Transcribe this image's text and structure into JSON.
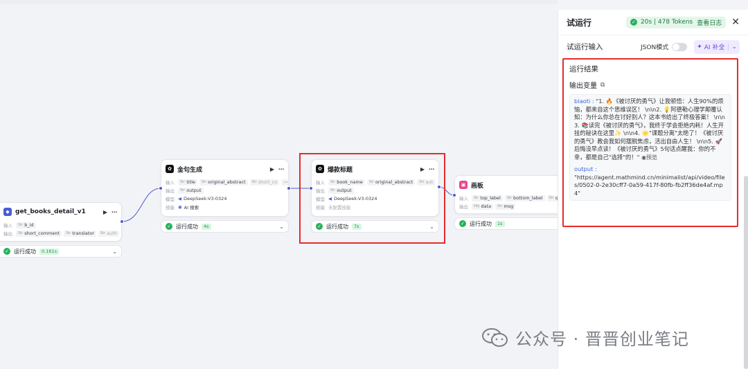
{
  "nodes": {
    "get_books": {
      "title": "get_books_detail_v1",
      "input_label": "输入",
      "input_var": "b_id",
      "output_label": "输出",
      "outputs": [
        "short_comment",
        "translator",
        "auth"
      ],
      "status": "运行成功",
      "time": "0.161s"
    },
    "jinju": {
      "title": "金句生成",
      "input_label": "输入",
      "inputs": [
        "title",
        "original_abstract",
        "short_co"
      ],
      "output_label": "输出",
      "output_var": "output",
      "model_label": "模型",
      "model": "DeepSeek-V3-0324",
      "skill_label": "技能",
      "skill": "AI 搜索",
      "status": "运行成功",
      "time": "4s"
    },
    "baokuan": {
      "title": "爆款标题",
      "input_label": "输入",
      "inputs": [
        "book_name",
        "original_abstract",
        "aut"
      ],
      "output_label": "输出",
      "output_var": "output",
      "model_label": "模型",
      "model": "DeepSeek-V3-0324",
      "skill_label": "技能",
      "skill": "未配置技能",
      "status": "运行成功",
      "time": "7s"
    },
    "huaban": {
      "title": "画板",
      "input_label": "输入",
      "inputs": [
        "top_label",
        "bottom_label",
        "quote"
      ],
      "output_label": "输出",
      "outputs": [
        "data",
        "msg"
      ],
      "status": "运行成功",
      "time": "1s"
    }
  },
  "panel": {
    "title": "试运行",
    "run_info": "20s | 478 Tokens",
    "view_log": "查看日志",
    "input_label": "试运行输入",
    "json_mode": "JSON模式",
    "ai_fill": "AI 补全",
    "results_title": "运行结果",
    "output_vars": "输出变量",
    "biaoti_key": "biaoti",
    "biaoti_value": "\"1. 🔥《被讨厌的勇气》让我顿悟：人生90%的烦恼，都来自这个思维误区！ \\n\\n2. 💡阿德勒心理学颠覆认知：为什么你总在讨好别人？这本书给出了终极答案！ \\n\\n3. 📚读完《被讨厌的勇气》，我终于学会拒绝内耗！人生开挂的秘诀在这里✨ \\n\\n4. 🌟\"课题分离\"太绝了！《被讨厌的勇气》教会我如何摆脱焦虑，活出自由人生！ \\n\\n5. 🚀后悔没早点读！《被讨厌的勇气》5句话点醒我：你的不幸，都是自己\"选择\"的！\"",
    "preview": "预览",
    "output_key": "output",
    "output_value": "\"https://agent.mathmind.cn/minimalist/api/video/files/0502-0-2e30cff7-0a59-417f-80fb-fb2ff36de4af.mp4\""
  },
  "watermark": "公众号 · 晋晋创业笔记",
  "colors": {
    "accent": "#4c5bd4",
    "success": "#27b15b",
    "highlight": "#e52b2b",
    "ai": "#6b45e0"
  }
}
